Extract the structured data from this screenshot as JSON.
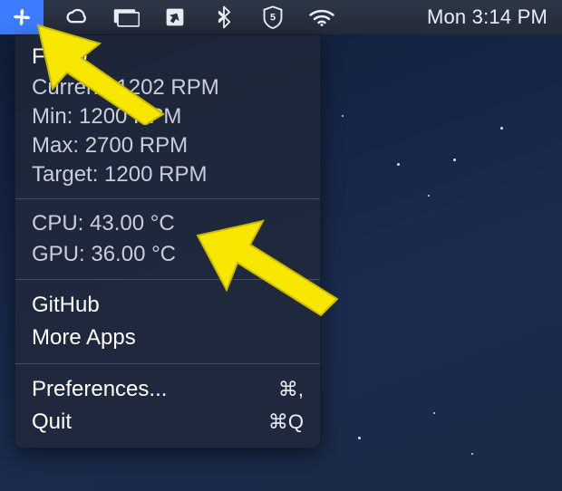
{
  "menubar": {
    "app_icon": "fan-icon",
    "icons": [
      "creative-cloud-icon",
      "screen-share-icon",
      "send-icon",
      "bluetooth-icon",
      "shield-5-icon",
      "wifi-icon"
    ],
    "clock": "Mon 3:14 PM"
  },
  "dropdown": {
    "fan": {
      "title": "Fan 0",
      "current_label": "Current:",
      "current_value": "1202 RPM",
      "min_label": "Min:",
      "min_value": "1200 RPM",
      "max_label": "Max:",
      "max_value": "2700 RPM",
      "target_label": "Target:",
      "target_value": "1200 RPM"
    },
    "temps": {
      "cpu_label": "CPU:",
      "cpu_value": "43.00 °C",
      "gpu_label": "GPU:",
      "gpu_value": "36.00 °C"
    },
    "links": {
      "github": "GitHub",
      "more_apps": "More Apps"
    },
    "commands": {
      "prefs_label": "Preferences...",
      "prefs_shortcut": "⌘,",
      "quit_label": "Quit",
      "quit_shortcut": "⌘Q"
    }
  },
  "annotations": {
    "arrow1": "yellow-arrow-pointing-up-left",
    "arrow2": "yellow-arrow-pointing-up-left"
  }
}
